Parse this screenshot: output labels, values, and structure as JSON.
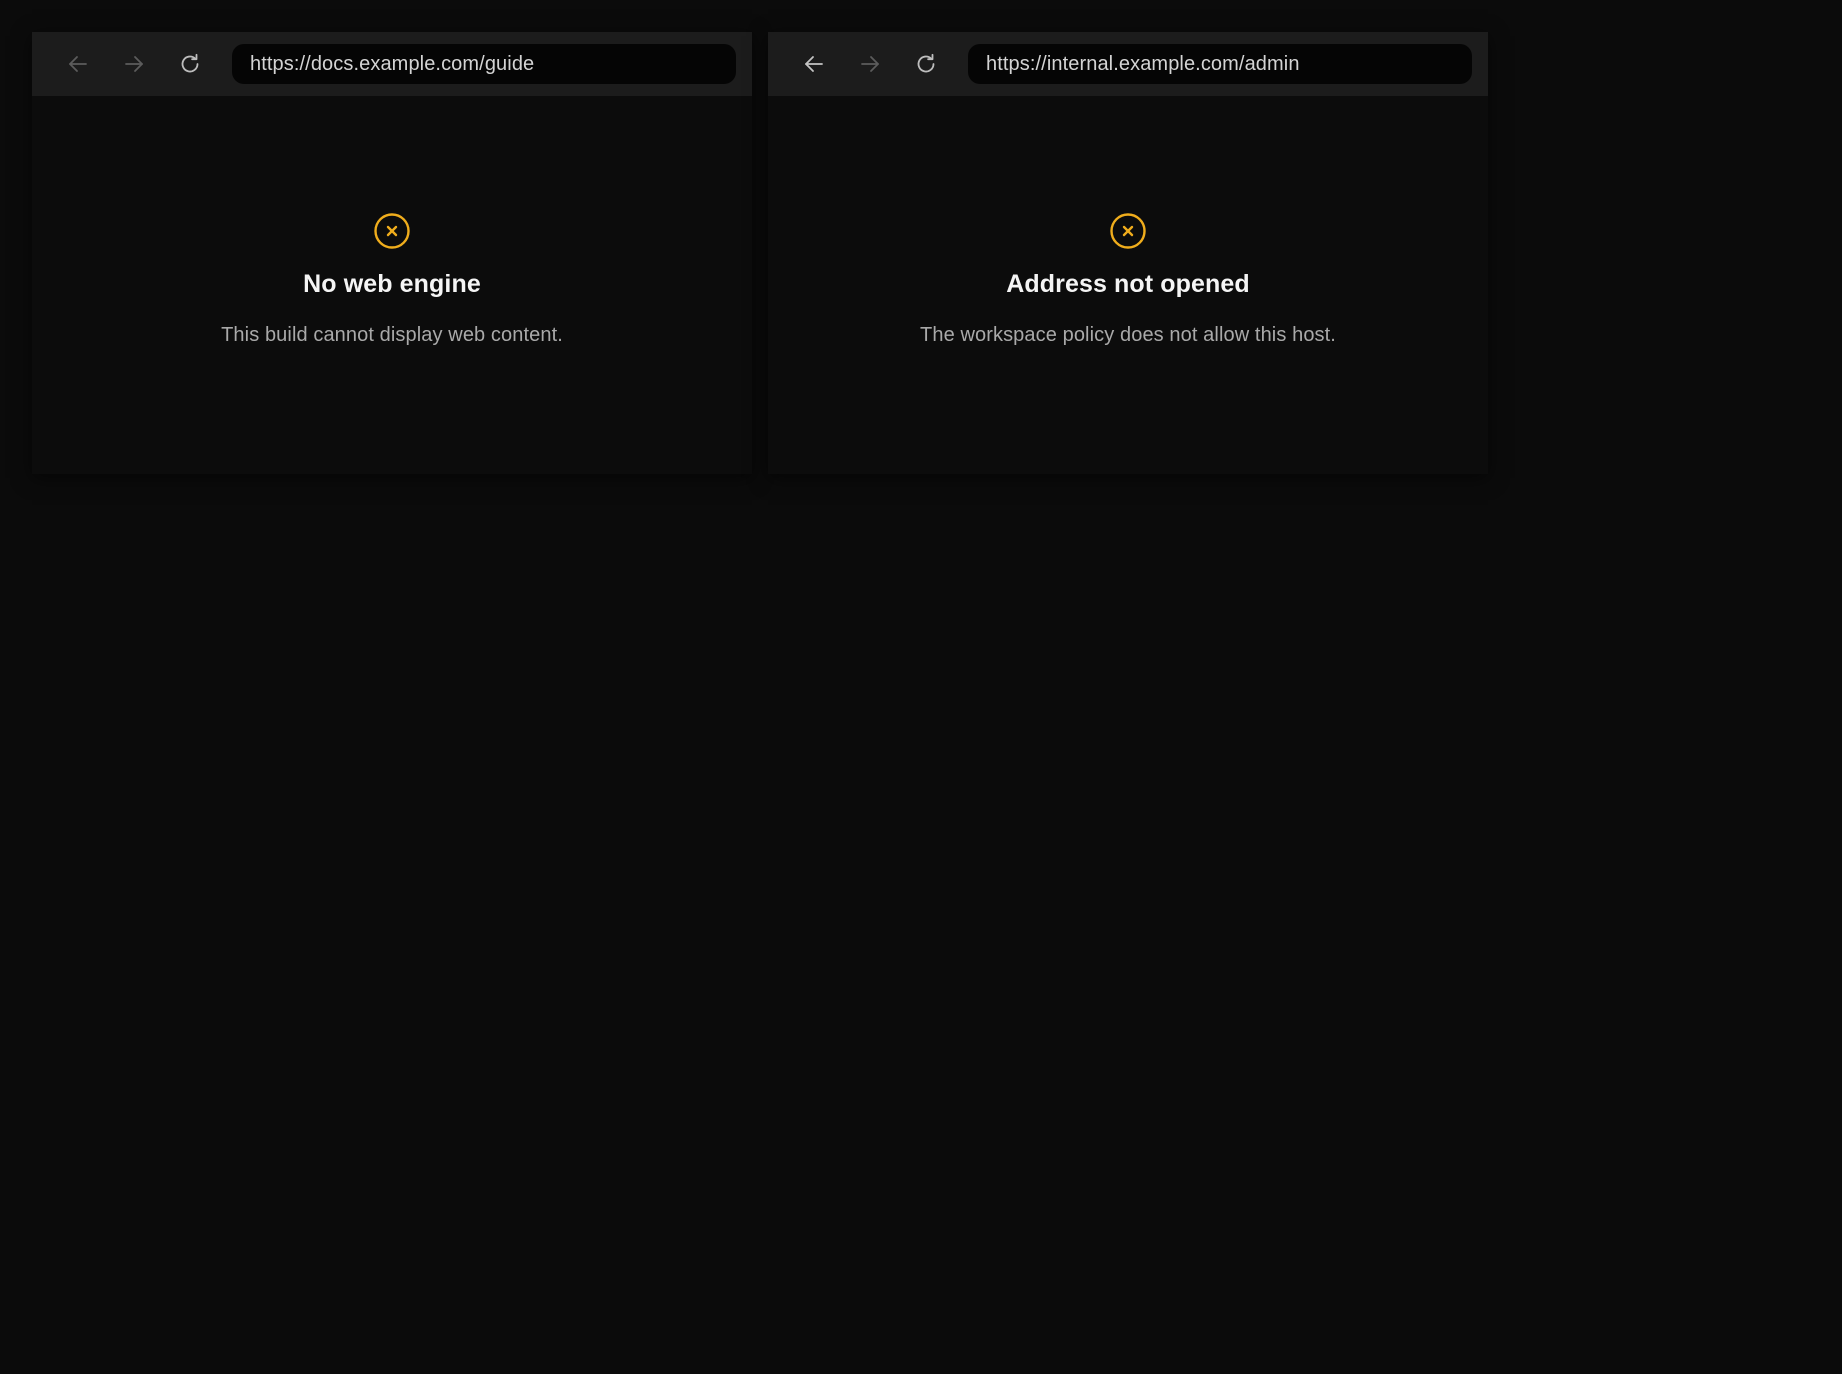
{
  "colors": {
    "background": "#0b0b0b",
    "toolbar": "#1c1c1c",
    "url_field": "#050505",
    "warning_accent": "#f0ad1c",
    "title_text": "#f5f5f5",
    "message_text": "#a9a9a9"
  },
  "panes": [
    {
      "toolbar": {
        "back_enabled": false,
        "forward_enabled": false,
        "back_icon": "arrow-left-icon",
        "forward_icon": "arrow-right-icon",
        "reload_icon": "reload-icon",
        "url": "https://docs.example.com/guide"
      },
      "error": {
        "icon": "close-circle-icon",
        "title": "No web engine",
        "message": "This build cannot display web content."
      }
    },
    {
      "toolbar": {
        "back_enabled": true,
        "forward_enabled": false,
        "back_icon": "arrow-left-icon",
        "forward_icon": "arrow-right-icon",
        "reload_icon": "reload-icon",
        "url": "https://internal.example.com/admin"
      },
      "error": {
        "icon": "close-circle-icon",
        "title": "Address not opened",
        "message": "The workspace policy does not allow this host."
      }
    }
  ]
}
